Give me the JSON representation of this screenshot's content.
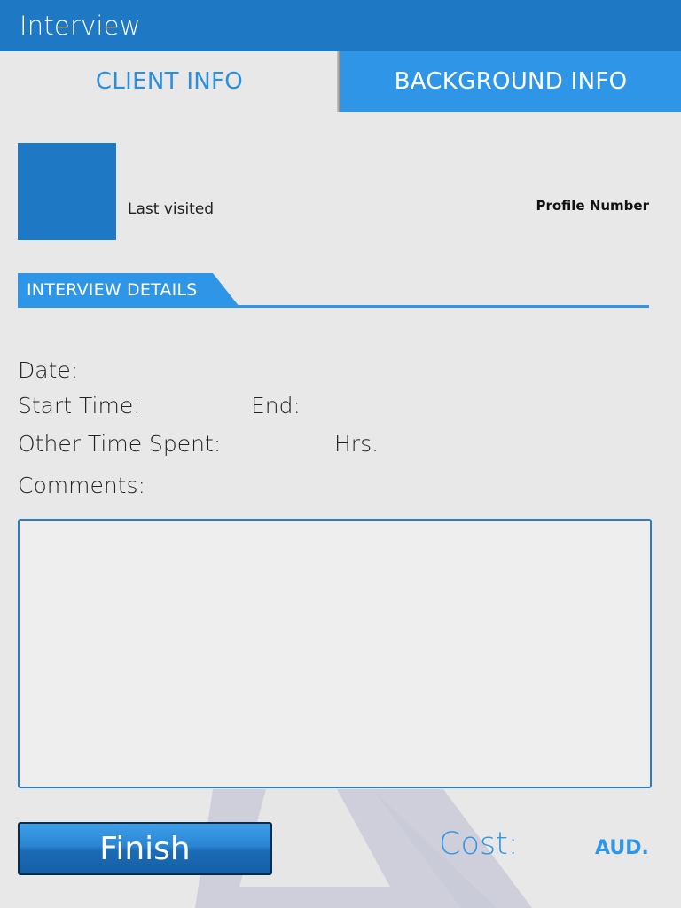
{
  "app": {
    "title": "Interview"
  },
  "tabs": [
    {
      "label": "CLIENT INFO",
      "active": false
    },
    {
      "label": "BACKGROUND INFO",
      "active": true
    }
  ],
  "profile": {
    "last_visited_label": "Last visited",
    "profile_number_label": "Profile Number"
  },
  "section": {
    "title": "INTERVIEW DETAILS"
  },
  "fields": {
    "date_label": "Date:",
    "start_time_label": "Start Time:",
    "end_label": "End:",
    "other_time_label": "Other Time Spent:",
    "hours_unit": "Hrs.",
    "comments_label": "Comments:",
    "comments_value": ""
  },
  "footer": {
    "finish_label": "Finish",
    "cost_label": "Cost:",
    "currency": "AUD."
  },
  "colors": {
    "primary": "#1f78c3",
    "accent": "#2f95e6",
    "background": "#e9e8e8"
  }
}
